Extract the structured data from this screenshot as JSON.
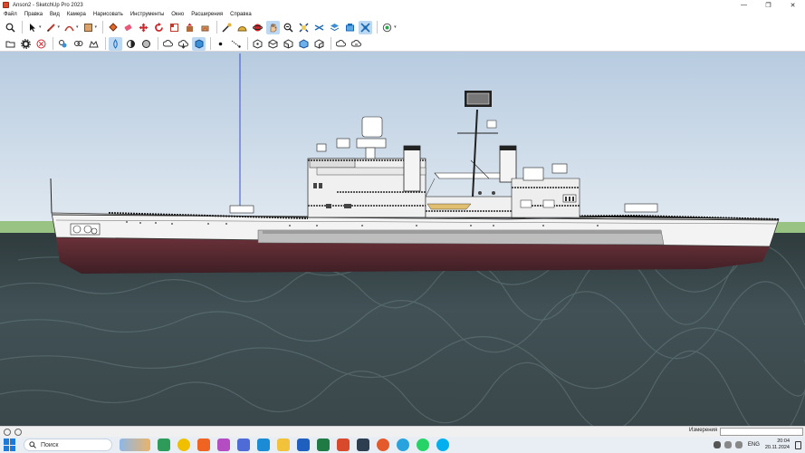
{
  "window": {
    "title": "Anson2 - SketchUp Pro 2023",
    "controls": {
      "minimize": "—",
      "maximize": "❐",
      "close": "✕"
    }
  },
  "menu": [
    "Файл",
    "Правка",
    "Вид",
    "Камера",
    "Нарисовать",
    "Инструменты",
    "Окно",
    "Расширения",
    "Справка"
  ],
  "toolbar_row1": [
    "zoom-icon",
    "select-arrow-icon",
    "pencil-line-icon",
    "arc-icon",
    "shape-rect-icon",
    "paint-bucket-icon",
    "eraser-icon",
    "move-icon",
    "rotate-icon",
    "scale-icon",
    "pushpull-icon",
    "offset-icon",
    "tape-icon",
    "protractor-icon",
    "orbit-icon",
    "pan-icon",
    "zoom-extents-icon",
    "section-plane-icon",
    "x-ray-icon",
    "layers-icon",
    "tags-icon",
    "styles-icon",
    "geo-location-icon"
  ],
  "toolbar_row2": [
    "open-folder-icon",
    "settings-gear-icon",
    "cancel-icon",
    "components-icon",
    "materials-icon",
    "warehouse-icon",
    "hidden-line-icon",
    "shaded-icon",
    "monochrome-icon",
    "upload-icon",
    "download-icon",
    "extension-icon",
    "point-icon",
    "dimension-icon",
    "iso-view-icon",
    "top-view-icon",
    "front-view-icon",
    "right-view-icon",
    "back-view-icon",
    "cloud-upload-icon",
    "cloud-sync-icon"
  ],
  "statusbar": {
    "measure_label": "Измерения",
    "measure_value": ""
  },
  "taskbar": {
    "search_placeholder": "Поиск",
    "lang": "ENG",
    "time": "20:04",
    "date": "20.11.2024"
  },
  "colors": {
    "sky_top": "#bcd0e4",
    "sky_bottom": "#dde7ef",
    "ground": "#8fbf7a",
    "water": "#3b4a4f",
    "hull_white": "#f4f4f4",
    "hull_red": "#5a2a31",
    "active_tool": "#bcd8f2"
  }
}
